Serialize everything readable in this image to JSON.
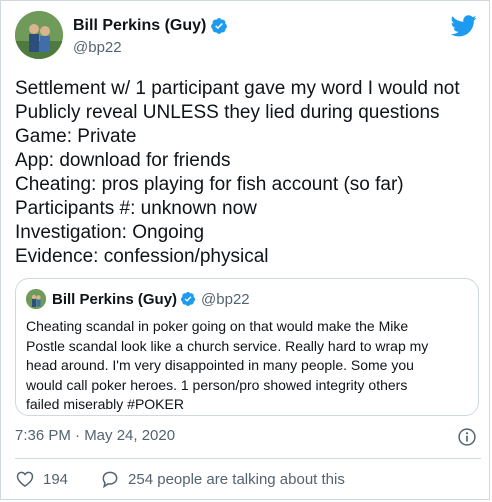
{
  "author": {
    "name": "Bill Perkins (Guy)",
    "handle": "@bp22"
  },
  "tweet": {
    "lines": [
      "Settlement w/ 1 participant gave my word I would not",
      "Publicly reveal UNLESS they lied during questions",
      "Game: Private",
      "App: download for friends",
      "Cheating: pros playing for fish account (so far)",
      "Participants #: unknown now",
      "Investigation: Ongoing",
      "Evidence: confession/physical"
    ],
    "timestamp": "7:36 PM · May 24, 2020"
  },
  "quoted": {
    "name": "Bill Perkins (Guy)",
    "handle": "@bp22",
    "lines": [
      "Cheating scandal in poker going on that would make the Mike",
      "Postle scandal look like a church service. Really hard to wrap my",
      "head around. I'm very disappointed in many people. Some you",
      "would call poker heroes. 1 person/pro showed integrity others",
      "failed miserably #POKER"
    ]
  },
  "actions": {
    "likes": "194",
    "talking": "254 people are talking about this"
  },
  "colors": {
    "brand_blue": "#1d9bf0",
    "secondary_text": "#536471",
    "border": "#cfd9de"
  },
  "icons": [
    "avatar-photo",
    "verified-badge-icon",
    "twitter-bird-icon",
    "info-icon",
    "heart-icon",
    "reply-bubble-icon"
  ]
}
